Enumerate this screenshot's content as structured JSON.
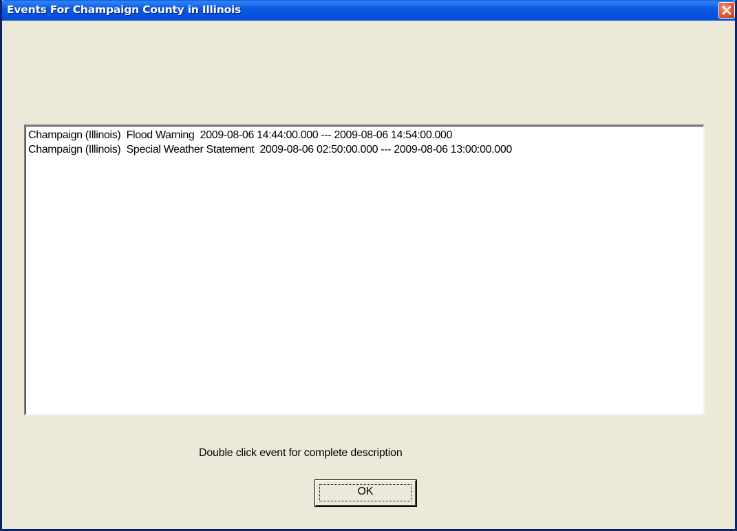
{
  "window": {
    "title": "Events For Champaign County in Illinois",
    "close_icon": "close-icon"
  },
  "events": {
    "items": [
      "Champaign (Illinois)  Flood Warning  2009-08-06 14:44:00.000 --- 2009-08-06 14:54:00.000",
      "Champaign (Illinois)  Special Weather Statement  2009-08-06 02:50:00.000 --- 2009-08-06 13:00:00.000"
    ]
  },
  "hint": {
    "text": "Double click event for complete description"
  },
  "buttons": {
    "ok_label": "OK"
  },
  "colors": {
    "titlebar": "#0A5DE0",
    "dialog_bg": "#ECE9D8",
    "close_button": "#E0603A"
  }
}
